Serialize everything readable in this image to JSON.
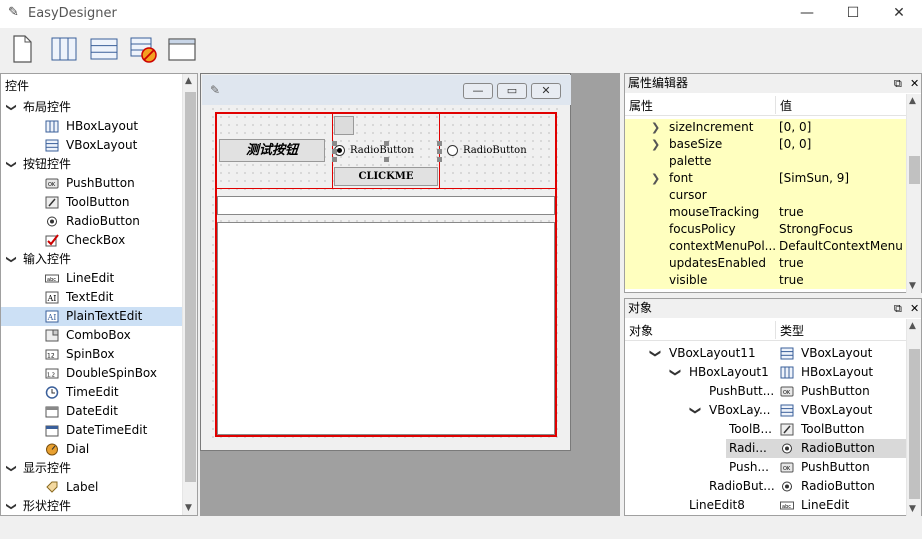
{
  "app": {
    "title": "EasyDesigner",
    "minimize": "—",
    "maximize": "☐",
    "close": "✕"
  },
  "left": {
    "title": "控件",
    "groups": [
      {
        "label": "布局控件",
        "items": [
          {
            "label": "HBoxLayout",
            "icon": "hbox-layout-icon"
          },
          {
            "label": "VBoxLayout",
            "icon": "vbox-layout-icon"
          }
        ]
      },
      {
        "label": "按钮控件",
        "items": [
          {
            "label": "PushButton",
            "icon": "pushbutton-icon"
          },
          {
            "label": "ToolButton",
            "icon": "toolbutton-icon"
          },
          {
            "label": "RadioButton",
            "icon": "radiobutton-icon"
          },
          {
            "label": "CheckBox",
            "icon": "checkbox-icon"
          }
        ]
      },
      {
        "label": "输入控件",
        "items": [
          {
            "label": "LineEdit",
            "icon": "lineedit-icon"
          },
          {
            "label": "TextEdit",
            "icon": "textedit-icon"
          },
          {
            "label": "PlainTextEdit",
            "icon": "plaintextedit-icon"
          },
          {
            "label": "ComboBox",
            "icon": "combobox-icon"
          },
          {
            "label": "SpinBox",
            "icon": "spinbox-icon"
          },
          {
            "label": "DoubleSpinBox",
            "icon": "doublespinbox-icon"
          },
          {
            "label": "TimeEdit",
            "icon": "timeedit-icon"
          },
          {
            "label": "DateEdit",
            "icon": "dateedit-icon"
          },
          {
            "label": "DateTimeEdit",
            "icon": "datetimeedit-icon"
          },
          {
            "label": "Dial",
            "icon": "dial-icon"
          }
        ]
      },
      {
        "label": "显示控件",
        "items": [
          {
            "label": "Label",
            "icon": "label-icon"
          }
        ]
      },
      {
        "label": "形状控件",
        "items": []
      }
    ]
  },
  "form": {
    "test_button": "测试按钮",
    "radio1": "RadioButton",
    "radio2": "RadioButton",
    "clickme": "CLICKME",
    "min": "—",
    "restore": "▭",
    "close": "✕"
  },
  "props": {
    "title": "属性编辑器",
    "col_name": "属性",
    "col_value": "值",
    "rows": [
      {
        "name": "sizeIncrement",
        "value": "[0, 0]",
        "expand": true
      },
      {
        "name": "baseSize",
        "value": "[0, 0]",
        "expand": true
      },
      {
        "name": "palette",
        "value": "",
        "expand": false
      },
      {
        "name": "font",
        "value": "[SimSun, 9]",
        "expand": true
      },
      {
        "name": "cursor",
        "value": "",
        "expand": false
      },
      {
        "name": "mouseTracking",
        "value": "true",
        "expand": false
      },
      {
        "name": "focusPolicy",
        "value": "StrongFocus",
        "expand": false
      },
      {
        "name": "contextMenuPol...",
        "value": "DefaultContextMenu",
        "expand": false
      },
      {
        "name": "updatesEnabled",
        "value": "true",
        "expand": false
      },
      {
        "name": "visible",
        "value": "true",
        "expand": false
      }
    ]
  },
  "objects": {
    "title": "对象",
    "col_object": "对象",
    "col_type": "类型",
    "rows": [
      {
        "name": "VBoxLayout11",
        "type": "VBoxLayout",
        "icon": "vbox-layout-icon",
        "level": 0,
        "expand": true
      },
      {
        "name": "HBoxLayout1",
        "type": "HBoxLayout",
        "icon": "hbox-layout-icon",
        "level": 1,
        "expand": true
      },
      {
        "name": "PushButt...",
        "type": "PushButton",
        "icon": "pushbutton-icon",
        "level": 2,
        "expand": false
      },
      {
        "name": "VBoxLay...",
        "type": "VBoxLayout",
        "icon": "vbox-layout-icon",
        "level": 2,
        "expand": true
      },
      {
        "name": "ToolB...",
        "type": "ToolButton",
        "icon": "toolbutton-icon",
        "level": 3,
        "expand": false
      },
      {
        "name": "Radi...",
        "type": "RadioButton",
        "icon": "radiobutton-icon",
        "level": 3,
        "expand": false
      },
      {
        "name": "Push...",
        "type": "PushButton",
        "icon": "pushbutton-icon",
        "level": 3,
        "expand": false
      },
      {
        "name": "RadioBut...",
        "type": "RadioButton",
        "icon": "radiobutton-icon",
        "level": 2,
        "expand": false
      },
      {
        "name": "LineEdit8",
        "type": "LineEdit",
        "icon": "lineedit-icon",
        "level": 1,
        "expand": false
      }
    ]
  }
}
